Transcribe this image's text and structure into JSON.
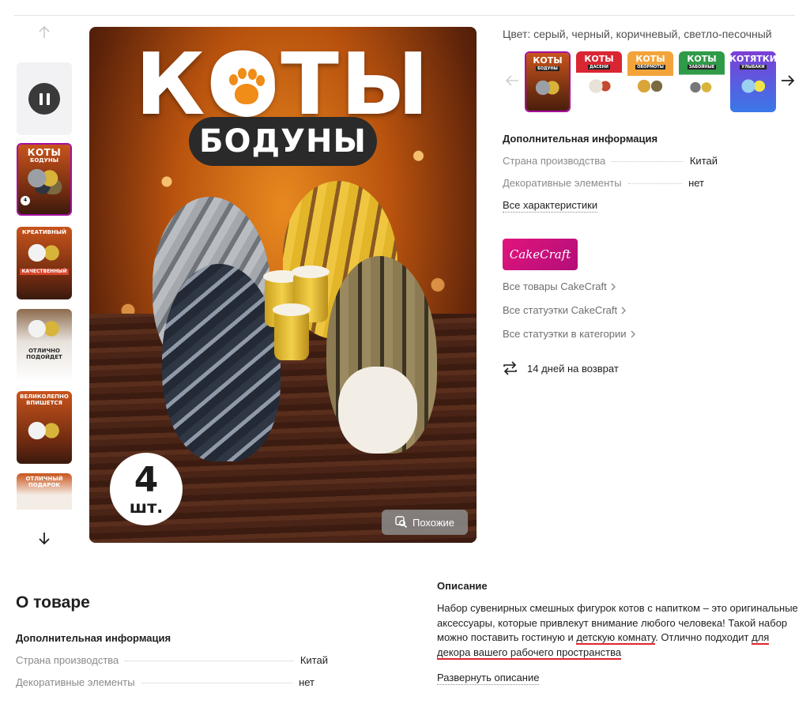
{
  "gallery": {
    "thumbnails": [
      {
        "title": "КОТЫ",
        "subtitle": "БОДУНЫ",
        "badge": "4"
      },
      {
        "title": "КРЕАТИВНЫЙ",
        "subtitle": "КАЧЕСТВЕННЫЙ"
      },
      {
        "title": "ОТЛИЧНО ПОДОЙДЕТ"
      },
      {
        "title": "ВЕЛИКОЛЕПНО ВПИШЕТСЯ"
      },
      {
        "title": "ОТЛИЧНЫЙ ПОДАРОК"
      }
    ]
  },
  "main_image": {
    "title": "КОТЫ",
    "subtitle": "БОДУНЫ",
    "count": "4",
    "count_unit": "шт.",
    "similar_button": "Похожие"
  },
  "product": {
    "color_line": "Цвет: серый, черный, коричневый, светло-песочный",
    "variants": [
      {
        "title": "КОТЫ",
        "sub": "БОДУНЫ"
      },
      {
        "title": "КОТЫ",
        "sub": "ДАСЕНИ"
      },
      {
        "title": "КОТЫ",
        "sub": "ОБОРМОТЫ"
      },
      {
        "title": "КОТЫ",
        "sub": "ЗАБОЙНЫЕ"
      },
      {
        "title": "КОТЯТКИ",
        "sub": "УЛЫБАКИ"
      }
    ],
    "extra_info_title": "Дополнительная информация",
    "specs": [
      {
        "key": "Страна производства",
        "value": "Китай"
      },
      {
        "key": "Декоративные элементы",
        "value": "нет"
      }
    ],
    "all_specs_link": "Все характеристики",
    "brand": {
      "logo_text": "CakeCraft",
      "links": [
        "Все товары CakeCraft",
        "Все статуэтки CakeCraft",
        "Все статуэтки в категории"
      ]
    },
    "return_policy": "14 дней на возврат"
  },
  "about": {
    "title": "О товаре",
    "extra_info_title": "Дополнительная информация",
    "specs": [
      {
        "key": "Страна производства",
        "value": "Китай"
      },
      {
        "key": "Декоративные элементы",
        "value": "нет"
      }
    ],
    "description_title": "Описание",
    "description_before": "Набор сувенирных смешных фигурок котов с напитком – это оригинальные аксессуары, которые привлекут внимание любого человека! Такой набор можно поставить гостиную и ",
    "description_link1": "детскую комнату",
    "description_middle": ". Отлично подходит ",
    "description_link2": "для декора вашего рабочего пространства",
    "expand_link": "Развернуть описание"
  },
  "colors": {
    "accent": "#a50fa0",
    "brand_pink": "#e2147c",
    "underline_red": "#e0252f"
  }
}
